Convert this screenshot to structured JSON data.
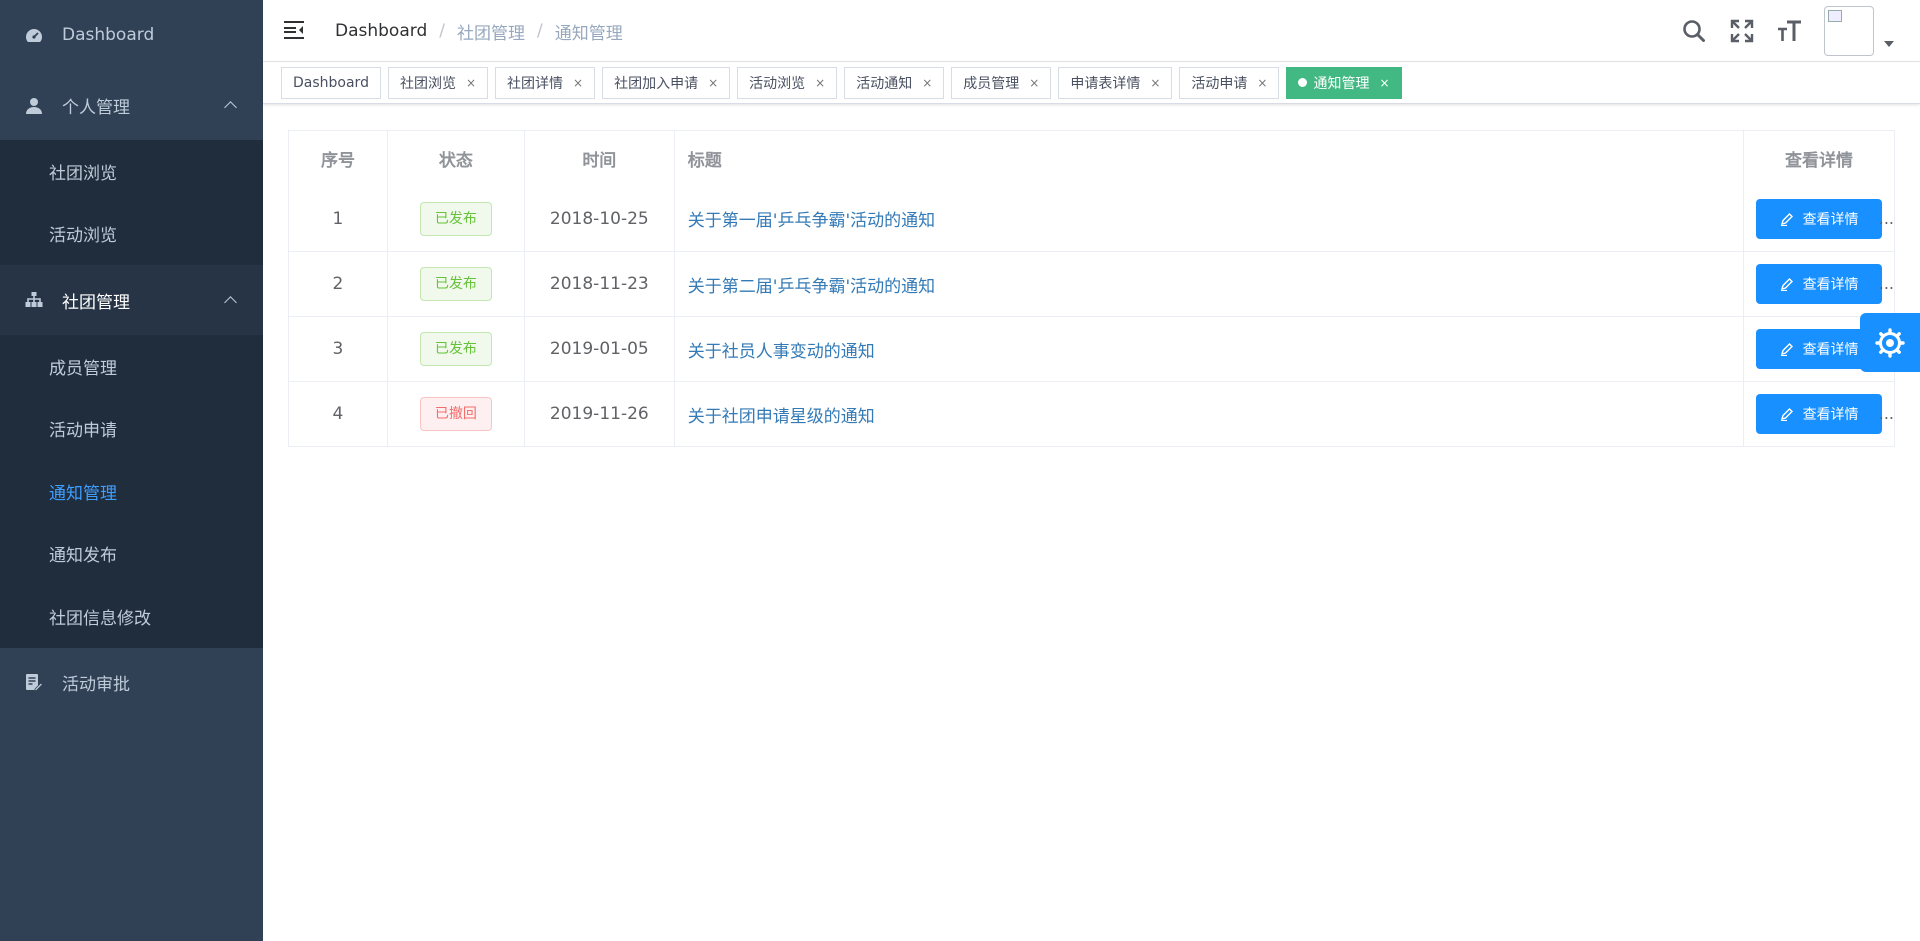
{
  "sidebar": {
    "dashboard": "Dashboard",
    "personal": {
      "label": "个人管理",
      "items": [
        "社团浏览",
        "活动浏览"
      ]
    },
    "club": {
      "label": "社团管理",
      "items": [
        "成员管理",
        "活动申请",
        "通知管理",
        "通知发布",
        "社团信息修改"
      ]
    },
    "approval": "活动审批",
    "active_item": "通知管理"
  },
  "navbar": {
    "breadcrumb": [
      "Dashboard",
      "社团管理",
      "通知管理"
    ],
    "separator": "/"
  },
  "tags": [
    {
      "label": "Dashboard",
      "closable": false,
      "active": false
    },
    {
      "label": "社团浏览",
      "closable": true,
      "active": false
    },
    {
      "label": "社团详情",
      "closable": true,
      "active": false
    },
    {
      "label": "社团加入申请",
      "closable": true,
      "active": false
    },
    {
      "label": "活动浏览",
      "closable": true,
      "active": false
    },
    {
      "label": "活动通知",
      "closable": true,
      "active": false
    },
    {
      "label": "成员管理",
      "closable": true,
      "active": false
    },
    {
      "label": "申请表详情",
      "closable": true,
      "active": false
    },
    {
      "label": "活动申请",
      "closable": true,
      "active": false
    },
    {
      "label": "通知管理",
      "closable": true,
      "active": true
    }
  ],
  "tag_close_symbol": "×",
  "table": {
    "headers": {
      "index": "序号",
      "status": "状态",
      "time": "时间",
      "title": "标题",
      "action": "查看详情"
    },
    "rows": [
      {
        "index": "1",
        "status": "已发布",
        "status_type": "ok",
        "time": "2018-10-25",
        "title": "关于第一届'乒乓争霸'活动的通知",
        "action": "查看详情"
      },
      {
        "index": "2",
        "status": "已发布",
        "status_type": "ok",
        "time": "2018-11-23",
        "title": "关于第二届'乒乓争霸'活动的通知",
        "action": "查看详情"
      },
      {
        "index": "3",
        "status": "已发布",
        "status_type": "ok",
        "time": "2019-01-05",
        "title": "关于社员人事变动的通知",
        "action": "查看详情"
      },
      {
        "index": "4",
        "status": "已撤回",
        "status_type": "bad",
        "time": "2019-11-26",
        "title": "关于社团申请星级的通知",
        "action": "查看详情"
      }
    ],
    "overflow_marker": "..."
  },
  "colors": {
    "sidebar_bg": "#304156",
    "submenu_bg": "#1f2d3d",
    "menu_active": "#409eff",
    "tag_active": "#42b983",
    "primary_button": "#1890ff",
    "status_published": "#67c23a",
    "status_revoked": "#f56c6c"
  },
  "icons": {
    "dashboard": "dashboard-gauge-icon",
    "personal": "user-icon",
    "club": "org-tree-icon",
    "approval": "document-edit-icon",
    "hamburger": "menu-fold-icon",
    "search": "search-icon",
    "fullscreen": "fullscreen-icon",
    "font_size": "font-size-icon",
    "settings": "gear-icon",
    "edit": "edit-pencil-icon"
  }
}
